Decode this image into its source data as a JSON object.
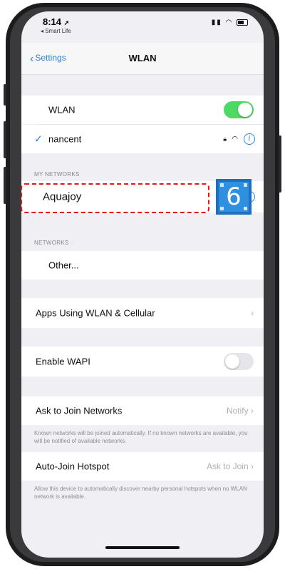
{
  "status_bar": {
    "time": "8:14",
    "back_app": "◂ Smart Life"
  },
  "nav": {
    "back_label": "Settings",
    "title": "WLAN"
  },
  "wlan": {
    "label": "WLAN",
    "enabled": true,
    "connected_network": "nancent"
  },
  "my_networks": {
    "header": "MY NETWORKS",
    "items": [
      {
        "name": "Aquajoy"
      }
    ]
  },
  "networks": {
    "header": "NETWORKS",
    "other_label": "Other..."
  },
  "apps_using": {
    "label": "Apps Using WLAN & Cellular"
  },
  "wapi": {
    "label": "Enable WAPI",
    "enabled": false
  },
  "ask_to_join": {
    "label": "Ask to Join Networks",
    "value": "Notify",
    "footnote": "Known networks will be joined automatically. If no known networks are available, you will be notified of available networks."
  },
  "auto_join_hotspot": {
    "label": "Auto-Join Hotspot",
    "value": "Ask to Join",
    "footnote": "Allow this device to automatically discover nearby personal hotspots when no WLAN network is available."
  },
  "annotation": {
    "step_number": "6",
    "highlight_color": "#e0191b",
    "badge_color": "#2f8fe0"
  },
  "colors": {
    "accent": "#2a84d6",
    "toggle_on": "#4cd964",
    "background": "#efeff4"
  }
}
